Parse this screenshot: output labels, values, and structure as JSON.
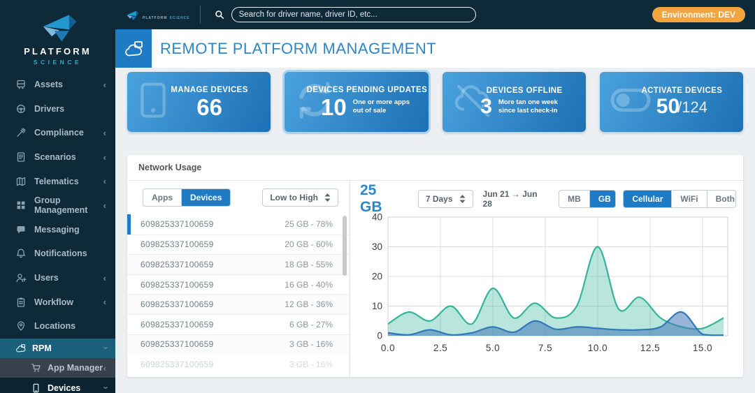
{
  "colors": {
    "accent": "#1e7bc4",
    "navy": "#0e2a38",
    "badge_orange": "#f2a43e",
    "title_blue": "#2e86c6"
  },
  "topbar": {
    "search_placeholder": "Search for driver name, driver ID, etc...",
    "environment_badge": "Environment: DEV",
    "brand": {
      "platform": "PLATFORM",
      "science": "SCIENCE"
    }
  },
  "sidebar": {
    "brand": {
      "platform": "PLATFORM",
      "science": "SCIENCE"
    },
    "items": [
      {
        "label": "Assets",
        "icon": "assets",
        "chevron": "left"
      },
      {
        "label": "Drivers",
        "icon": "drivers",
        "chevron": null
      },
      {
        "label": "Compliance",
        "icon": "compliance",
        "chevron": "left"
      },
      {
        "label": "Scenarios",
        "icon": "scenarios",
        "chevron": "left"
      },
      {
        "label": "Telematics",
        "icon": "telematics",
        "chevron": "left"
      },
      {
        "label": "Group Management",
        "icon": "group-management",
        "chevron": "left"
      },
      {
        "label": "Messaging",
        "icon": "messaging",
        "chevron": null
      },
      {
        "label": "Notifications",
        "icon": "notifications",
        "chevron": null
      },
      {
        "label": "Users",
        "icon": "users",
        "chevron": "left"
      },
      {
        "label": "Workflow",
        "icon": "workflow",
        "chevron": "left"
      },
      {
        "label": "Locations",
        "icon": "locations",
        "chevron": null
      }
    ],
    "rpm_items": [
      {
        "label": "RPM",
        "icon": "rpm",
        "chevron": "down",
        "style": "rpm-main"
      },
      {
        "label": "App Manager",
        "icon": "app-manager",
        "chevron": "left",
        "style": "rpm-sub-gray"
      },
      {
        "label": "Devices",
        "icon": "devices",
        "chevron": "down",
        "style": "rpm-sub-dark"
      }
    ]
  },
  "header": {
    "title": "REMOTE PLATFORM MANAGEMENT"
  },
  "cards": [
    {
      "title": "MANAGE DEVICES",
      "value": "66",
      "icon": "tablet"
    },
    {
      "title": "DEVICES PENDING UPDATES",
      "value": "10",
      "subtitle": "One or more apps out of sale",
      "icon": "sync",
      "selected": true
    },
    {
      "title": "DEVICES OFFLINE",
      "value": "3",
      "subtitle": "More tan one week since last check-in",
      "icon": "cloud-offline"
    },
    {
      "title": "ACTIVATE DEVICES",
      "value": "50",
      "value_suffix": "/124",
      "icon": "toggle"
    }
  ],
  "network_usage": {
    "title": "Network Usage",
    "view_toggle": {
      "options": [
        "Apps",
        "Devices"
      ],
      "selected": "Devices"
    },
    "sort_label": "Low to High",
    "rows": [
      {
        "id": "609825337100659",
        "usage": "25 GB - 78%",
        "selected": true
      },
      {
        "id": "609825337100659",
        "usage": "20 GB - 60%"
      },
      {
        "id": "609825337100659",
        "usage": "18 GB -  55%"
      },
      {
        "id": "609825337100659",
        "usage": "16 GB -  40%"
      },
      {
        "id": "609825337100659",
        "usage": "12 GB -  36%"
      },
      {
        "id": "609825337100659",
        "usage": "6 GB -  27%"
      },
      {
        "id": "609825337100659",
        "usage": "3 GB -  16%"
      },
      {
        "id": "609825337100659",
        "usage": "3 GB -  16%",
        "faded": true
      }
    ],
    "chart_header": {
      "total": "25 GB",
      "range": "7 Days",
      "dates": "Jun 21 → Jun 28",
      "unit_toggle": {
        "options": [
          "MB",
          "GB"
        ],
        "selected": "GB"
      },
      "network_toggle": {
        "options": [
          "Cellular",
          "WiFi",
          "Both"
        ],
        "selected": "Cellular"
      }
    }
  },
  "chart_data": {
    "type": "area",
    "x": [
      0,
      1,
      2,
      3,
      4,
      5,
      6,
      7,
      8,
      9,
      10,
      11,
      12,
      13,
      14,
      15,
      16
    ],
    "series": [
      {
        "name": "green",
        "color": "#35b49b",
        "fill": "rgba(53,180,155,0.35)",
        "values": [
          4,
          8,
          5,
          10,
          4,
          16,
          6,
          11,
          6,
          10,
          30,
          9,
          13,
          6,
          3,
          2.5,
          6
        ]
      },
      {
        "name": "blue",
        "color": "#2e78bb",
        "fill": "rgba(66,121,180,0.55)",
        "values": [
          1,
          0.3,
          2,
          0.3,
          1,
          3,
          1.2,
          5,
          2.2,
          3,
          2.5,
          2,
          2,
          3,
          8,
          0.5,
          0.2
        ]
      }
    ],
    "xlim": [
      0,
      16.2
    ],
    "ylim": [
      0,
      40
    ],
    "xticks": [
      0,
      2.5,
      5,
      7.5,
      10,
      12.5,
      15
    ],
    "yticks": [
      0,
      10,
      20,
      30,
      40
    ],
    "grid": true,
    "legend": false,
    "title": "",
    "xlabel": "",
    "ylabel": ""
  }
}
